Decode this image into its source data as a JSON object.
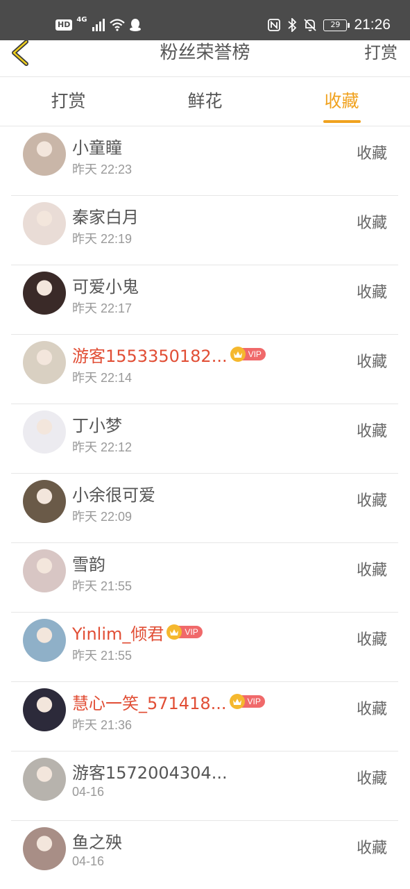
{
  "status_bar": {
    "hd": "HD",
    "network": "4G",
    "battery": "29",
    "time": "21:26"
  },
  "header": {
    "title": "粉丝荣誉榜",
    "action": "打赏"
  },
  "tabs": [
    {
      "label": "打赏",
      "active": false
    },
    {
      "label": "鲜花",
      "active": false
    },
    {
      "label": "收藏",
      "active": true
    }
  ],
  "vip_label": "VIP",
  "colors": {
    "accent": "#f0a21f",
    "vip_name": "#e14e35",
    "vip_badge": "#f0696a",
    "crown": "#f5b82e",
    "status_bar": "#4b4b4b"
  },
  "fans": [
    {
      "name": "小童瞳",
      "time": "昨天 22:23",
      "action": "收藏",
      "vip": false,
      "avatar_color": "#c9b6a8"
    },
    {
      "name": "秦家白月",
      "time": "昨天 22:19",
      "action": "收藏",
      "vip": false,
      "avatar_color": "#e9dcd6"
    },
    {
      "name": "可爱小鬼",
      "time": "昨天 22:17",
      "action": "收藏",
      "vip": false,
      "avatar_color": "#3a2a28"
    },
    {
      "name": "游客1553350182...",
      "time": "昨天 22:14",
      "action": "收藏",
      "vip": true,
      "avatar_color": "#d9d0c2"
    },
    {
      "name": "丁小梦",
      "time": "昨天 22:12",
      "action": "收藏",
      "vip": false,
      "avatar_color": "#ecebf0"
    },
    {
      "name": "小余很可爱",
      "time": "昨天 22:09",
      "action": "收藏",
      "vip": false,
      "avatar_color": "#6a5a48"
    },
    {
      "name": "雪韵",
      "time": "昨天 21:55",
      "action": "收藏",
      "vip": false,
      "avatar_color": "#d8c6c4"
    },
    {
      "name": "Yinlim_倾君",
      "time": "昨天 21:55",
      "action": "收藏",
      "vip": true,
      "avatar_color": "#8fb0c8"
    },
    {
      "name": "慧心一笑_571418...",
      "time": "昨天 21:36",
      "action": "收藏",
      "vip": true,
      "avatar_color": "#2c2a3a"
    },
    {
      "name": "游客1572004304...",
      "time": "04-16",
      "action": "收藏",
      "vip": false,
      "avatar_color": "#b7b3ad"
    },
    {
      "name": "鱼之殃",
      "time": "04-16",
      "action": "收藏",
      "vip": false,
      "avatar_color": "#a88e86"
    }
  ]
}
